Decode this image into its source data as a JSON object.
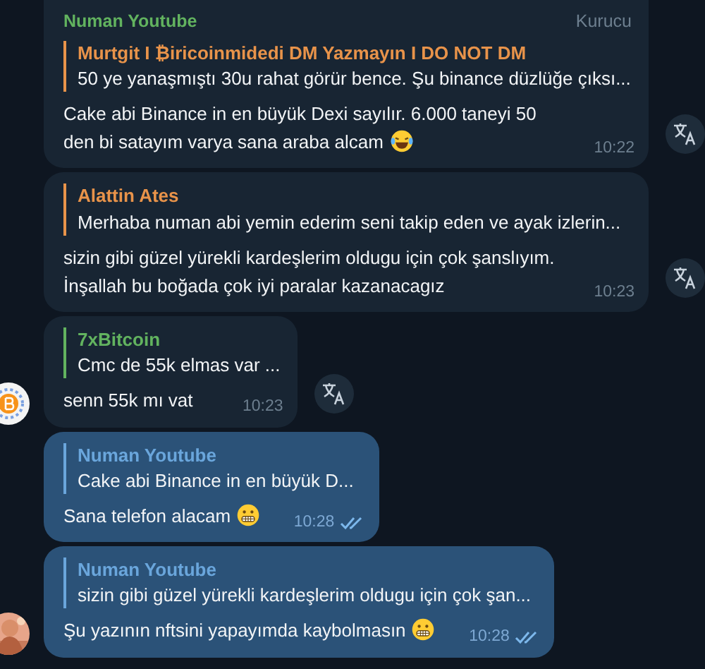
{
  "messages": [
    {
      "kind": "incoming",
      "sender": {
        "name": "Numan Youtube",
        "color": "#62b35f"
      },
      "badge": "Kurucu",
      "reply": {
        "name": "Murtgit I ₿iricoinmidedi DM Yazmayın I DO NOT DM",
        "color": "#e8934a",
        "text": "50 ye yanaşmıştı 30u rahat görür bence. Şu binance düzlüğe çıksı..."
      },
      "body": "Cake abi Binance in en büyük Dexi sayılır. 6.000 taneyi 50 den bi satayım varya sana araba alcam",
      "emoji": {
        "kind": "laughing"
      },
      "time": "10:22",
      "translate": true
    },
    {
      "kind": "incoming",
      "reply": {
        "name": "Alattin Ates",
        "color": "#e8934a",
        "text": "Merhaba numan abi yemin ederim seni takip eden ve ayak izlerin..."
      },
      "body": "sizin gibi güzel yürekli kardeşlerim oldugu için çok şanslıyım. İnşallah bu boğada çok iyi paralar kazanacagız",
      "time": "10:23",
      "translate": true
    },
    {
      "kind": "incoming",
      "reply": {
        "name": "7xBitcoin",
        "color": "#62b35f",
        "text": "Cmc de 55k elmas var ..."
      },
      "body": "senn 55k mı vat",
      "time": "10:23",
      "translate": true,
      "avatar": {
        "kind": "logo"
      }
    },
    {
      "kind": "outgoing",
      "reply": {
        "name": "Numan Youtube",
        "color": "#6aa6dc",
        "text": "Cake abi Binance in en büyük D..."
      },
      "body": "Sana telefon alacam",
      "emoji": {
        "kind": "grinning"
      },
      "time": "10:28",
      "read": true
    },
    {
      "kind": "outgoing",
      "reply": {
        "name": "Numan Youtube",
        "color": "#6aa6dc",
        "text": "sizin gibi güzel yürekli kardeşlerim oldugu için çok şan..."
      },
      "body": "Şu yazının nftsini yapayımda kaybolmasın",
      "emoji": {
        "kind": "grinning"
      },
      "time": "10:28",
      "read": true
    }
  ]
}
